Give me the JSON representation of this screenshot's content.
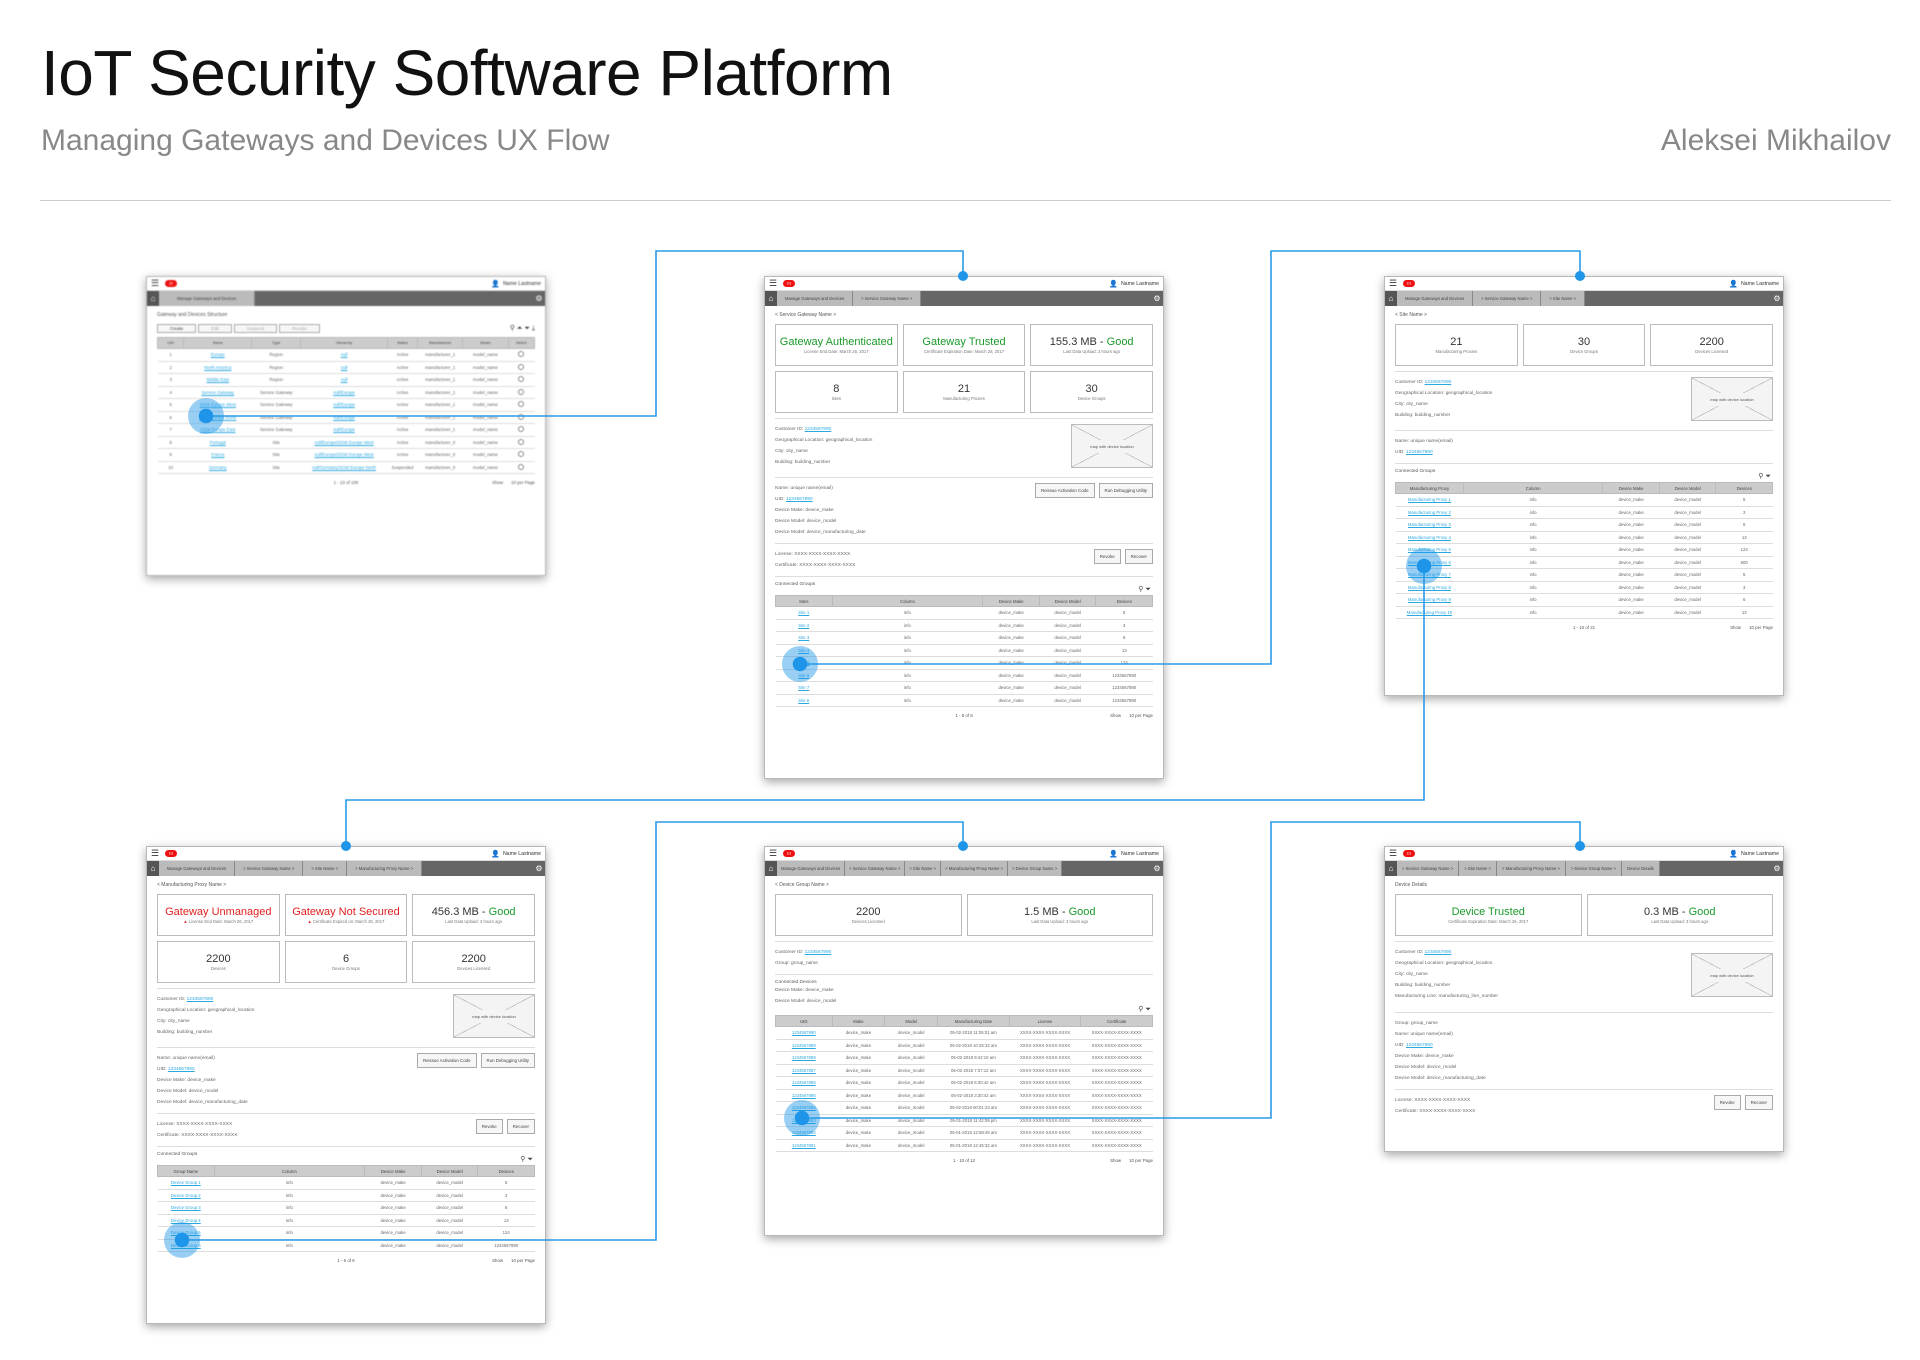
{
  "header": {
    "title": "IoT Security Software Platform",
    "subtitle": "Managing Gateways and Devices UX Flow",
    "author": "Aleksei Mikhailov"
  },
  "common": {
    "user_name": "Name Lastname",
    "map_label": "map with device location",
    "show_label": "Show",
    "per_page": "10 per Page",
    "revoke": "Revoke",
    "recover": "Recover",
    "reissue": "Reissue Activation Code",
    "debug": "Run Debugging Utility",
    "connected_groups": "Connected Groups",
    "connected_devices": "Connected Devices",
    "customer_id_label": "Customer ID:",
    "customer_id": "1234567890",
    "geo_label": "Geographical Location:",
    "geo": "geographical_location",
    "city_label": "City:",
    "city": "city_name",
    "building_label": "Building:",
    "building": "building_number",
    "name_label": "Name:",
    "name": "unique name(email)",
    "uid_label": "UID:",
    "uid": "1234567890",
    "make_label": "Device Make:",
    "make": "device_make",
    "model_label": "Device Model:",
    "model": "device_model",
    "model2_label": "Device Model:",
    "model2": "device_manufacturing_date",
    "license_label": "License:",
    "license": "XXXX-XXXX-XXXX-XXXX",
    "cert_label": "Certificate:",
    "cert": "XXXX-XXXX-XXXX-XXXX",
    "group_label": "Group:",
    "group": "group_name",
    "mfg_label": "Manufacturing Line:",
    "mfg": "manufacturing_line_number"
  },
  "screen1": {
    "crumbs": [
      "Manage Gateways and Devices"
    ],
    "title": "Gateway and Devices Structure",
    "tabs": [
      "Create",
      "Edit",
      "Suspend",
      "Revoke"
    ],
    "columns": [
      "UID",
      "Name",
      "Type",
      "Hierarchy",
      "Status",
      "Manufacturer",
      "Model",
      "Select"
    ],
    "rows": [
      [
        "1",
        "Europe",
        "Region",
        "null",
        "Active",
        "manufacturer_1",
        "model_name"
      ],
      [
        "2",
        "North America",
        "Region",
        "null",
        "Active",
        "manufacturer_1",
        "model_name"
      ],
      [
        "3",
        "Middle East",
        "Region",
        "null",
        "Active",
        "manufacturer_1",
        "model_name"
      ],
      [
        "4",
        "Service Gateway",
        "Service Gateway",
        "null/Europe",
        "Active",
        "manufacturer_1",
        "model_name"
      ],
      [
        "5",
        "SGW Europe West",
        "Service Gateway",
        "null/Europe",
        "Active",
        "manufacturer_1",
        "model_name"
      ],
      [
        "6",
        "SGW Europe North",
        "Service Gateway",
        "null/Europe",
        "Active",
        "manufacturer_1",
        "model_name"
      ],
      [
        "7",
        "SGW Europe East",
        "Service Gateway",
        "null/Europe",
        "Active",
        "manufacturer_1",
        "model_name"
      ],
      [
        "8",
        "Portugal",
        "Site",
        "null/Europe/SGW Europe West",
        "Active",
        "manufacturer_0",
        "model_name"
      ],
      [
        "9",
        "France",
        "Site",
        "null/Europe/SGW Europe West",
        "Active",
        "manufacturer_0",
        "model_name"
      ],
      [
        "10",
        "Germany",
        "Site",
        "null/Germany/SGW Europe North",
        "Suspended",
        "manufacturer_0",
        "model_name"
      ]
    ],
    "pager": "1 - 10  of 100",
    "per_page": "10 per Page"
  },
  "screen2": {
    "crumbs": [
      "Manage Gateways and Devices",
      "> Service Gateway Name >"
    ],
    "back": "< Service Gateway Name >",
    "cards": [
      {
        "big": "Gateway Authenticated",
        "small": "License End Date: March 26, 2017"
      },
      {
        "big": "Gateway Trusted",
        "small": "Certificate Expiration Date: March 26, 2017"
      },
      {
        "big": "155.3 MB - ",
        "good": "Good",
        "small": "Last Data Upload: 3 hours ago"
      },
      {
        "big": "8",
        "small": "Sites"
      },
      {
        "big": "21",
        "small": "Manufacturing Proxies"
      },
      {
        "big": "30",
        "small": "Device Groups"
      }
    ],
    "columns": [
      "Sites",
      "Column",
      "Device Make",
      "Device Model",
      "Devices"
    ],
    "rows": [
      [
        "Site 1",
        "info",
        "device_make",
        "device_model",
        "5"
      ],
      [
        "Site 2",
        "info",
        "device_make",
        "device_model",
        "3"
      ],
      [
        "Site 3",
        "info",
        "device_make",
        "device_model",
        "6"
      ],
      [
        "Site 4",
        "info",
        "device_make",
        "device_model",
        "13"
      ],
      [
        "Site 5",
        "info",
        "device_make",
        "device_model",
        "124"
      ],
      [
        "Site 6",
        "info",
        "device_make",
        "device_model",
        "1234567890"
      ],
      [
        "Site 7",
        "info",
        "device_make",
        "device_model",
        "1234567890"
      ],
      [
        "Site 8",
        "info",
        "device_make",
        "device_model",
        "1234567890"
      ]
    ],
    "pager": "1 - 8  of 8"
  },
  "screen3": {
    "crumbs": [
      "Manage Gateways and Devices",
      "> Service Gateway Name >",
      "> Site Name >"
    ],
    "back": "< Site Name >",
    "cards": [
      {
        "big": "21",
        "small": "Manufacturing Proxies"
      },
      {
        "big": "30",
        "small": "Device Groups"
      },
      {
        "big": "2200",
        "small": "Devices Licensed"
      }
    ],
    "columns": [
      "Manufacturing Proxy",
      "Column",
      "Device Make",
      "Device Model",
      "Devices"
    ],
    "rows": [
      [
        "Manufacturing Proxy 1",
        "info",
        "device_make",
        "device_model",
        "5"
      ],
      [
        "Manufacturing Proxy 2",
        "info",
        "device_make",
        "device_model",
        "3"
      ],
      [
        "Manufacturing Proxy 3",
        "info",
        "device_make",
        "device_model",
        "6"
      ],
      [
        "Manufacturing Proxy 4",
        "info",
        "device_make",
        "device_model",
        "13"
      ],
      [
        "Manufacturing Proxy 5",
        "info",
        "device_make",
        "device_model",
        "124"
      ],
      [
        "Manufacturing Proxy 6",
        "info",
        "device_make",
        "device_model",
        "600"
      ],
      [
        "Manufacturing Proxy 7",
        "info",
        "device_make",
        "device_model",
        "5"
      ],
      [
        "Manufacturing Proxy 8",
        "info",
        "device_make",
        "device_model",
        "3"
      ],
      [
        "Manufacturing Proxy 9",
        "info",
        "device_make",
        "device_model",
        "6"
      ],
      [
        "Manufacturing Proxy 10",
        "info",
        "device_make",
        "device_model",
        "13"
      ]
    ],
    "pager": "1 - 10  of 21"
  },
  "screen4": {
    "crumbs": [
      "Manage Gateways and Devices",
      "> Service Gateway Name >",
      "> Site Name >",
      "> Manufacturing Proxy Name >"
    ],
    "back": "< Manufacturing Proxy Name >",
    "cards": [
      {
        "big": "Gateway Unmanaged",
        "small": "License End Date: March 26, 2017",
        "warn": true
      },
      {
        "big": "Gateway Not Secured",
        "small": "Certificate Expired on: March 26, 2017",
        "warn": true
      },
      {
        "big": "456.3 MB - ",
        "good": "Good",
        "small": "Last Data Upload: 3 hours ago"
      },
      {
        "big": "2200",
        "small": "Devices"
      },
      {
        "big": "6",
        "small": "Device Groups"
      },
      {
        "big": "2200",
        "small": "Devices Licensed"
      }
    ],
    "columns": [
      "Group Name",
      "Column",
      "Device Make",
      "Device Model",
      "Devices"
    ],
    "rows": [
      [
        "Device Group 1",
        "info",
        "device_make",
        "device_model",
        "5"
      ],
      [
        "Device Group 2",
        "info",
        "device_make",
        "device_model",
        "3"
      ],
      [
        "Device Group 3",
        "info",
        "device_make",
        "device_model",
        "6"
      ],
      [
        "Device Group 4",
        "info",
        "device_make",
        "device_model",
        "13"
      ],
      [
        "Device Group 5",
        "info",
        "device_make",
        "device_model",
        "124"
      ],
      [
        "Device Group 6",
        "info",
        "device_make",
        "device_model",
        "1234567890"
      ]
    ],
    "pager": "1 - 6  of 6"
  },
  "screen5": {
    "crumbs": [
      "Manage Gateways and Devices",
      "> Service Gateway Name >",
      "> Site Name >",
      "> Manufacturing Proxy Name >",
      "> Device Group Name >"
    ],
    "back": "< Device Group Name >",
    "cards": [
      {
        "big": "2200",
        "small": "Devices Licensed"
      },
      {
        "big": "1.5 MB - ",
        "good": "Good",
        "small": "Last Data Upload: 3 hours ago"
      }
    ],
    "columns": [
      "UID",
      "Make",
      "Model",
      "Manufacturing Date",
      "License",
      "Certificate"
    ],
    "rows": [
      [
        "1234567890",
        "device_make",
        "device_model",
        "05-02-2018 11:05:01 am",
        "XXXX-XXXX-XXXX-XXXX",
        "XXXX-XXXX-XXXX-XXXX"
      ],
      [
        "1234567889",
        "device_make",
        "device_model",
        "05-02-2018 10:25:32 am",
        "XXXX-XXXX-XXXX-XXXX",
        "XXXX-XXXX-XXXX-XXXX"
      ],
      [
        "1234567888",
        "device_make",
        "device_model",
        "05-02-2018 9:42:10 am",
        "XXXX-XXXX-XXXX-XXXX",
        "XXXX-XXXX-XXXX-XXXX"
      ],
      [
        "1234567887",
        "device_make",
        "device_model",
        "05-02-2018 7:37:12 am",
        "XXXX-XXXX-XXXX-XXXX",
        "XXXX-XXXX-XXXX-XXXX"
      ],
      [
        "1234567886",
        "device_make",
        "device_model",
        "05-02-2018 5:30:42 am",
        "XXXX-XXXX-XXXX-XXXX",
        "XXXX-XXXX-XXXX-XXXX"
      ],
      [
        "1234567885",
        "device_make",
        "device_model",
        "05-02-2018 3:30:42 am",
        "XXXX-XXXX-XXXX-XXXX",
        "XXXX-XXXX-XXXX-XXXX"
      ],
      [
        "1234567884",
        "device_make",
        "device_model",
        "05-02-2018 00:01:23 am",
        "XXXX-XXXX-XXXX-XXXX",
        "XXXX-XXXX-XXXX-XXXX"
      ],
      [
        "1234567883",
        "device_make",
        "device_model",
        "05-01-2018 11:42:09 pm",
        "XXXX-XXXX-XXXX-XXXX",
        "XXXX-XXXX-XXXX-XXXX"
      ],
      [
        "1234567882",
        "device_make",
        "device_model",
        "05-01-2018 12:58:45 am",
        "XXXX-XXXX-XXXX-XXXX",
        "XXXX-XXXX-XXXX-XXXX"
      ],
      [
        "1234567881",
        "device_make",
        "device_model",
        "05-01-2018 12:45:32 am",
        "XXXX-XXXX-XXXX-XXXX",
        "XXXX-XXXX-XXXX-XXXX"
      ]
    ],
    "pager": "1 - 10  of 12"
  },
  "screen6": {
    "crumbs": [
      "> Service Gateway Name >",
      "> Site Name >",
      "> Manufacturing Proxy Name >",
      "> Device Group Name >",
      "Device Details"
    ],
    "back": "Device Details",
    "cards": [
      {
        "big": "Device Trusted",
        "small": "Certificate Expiration Date: March 26, 2017"
      },
      {
        "big": "0.3 MB - ",
        "good": "Good",
        "small": "Last Data Upload: 3 hours ago"
      }
    ]
  },
  "colors": {
    "accent": "#1e95e8",
    "good": "#1a9a2a",
    "alert": "#e02020",
    "link": "#2aa8e0"
  }
}
